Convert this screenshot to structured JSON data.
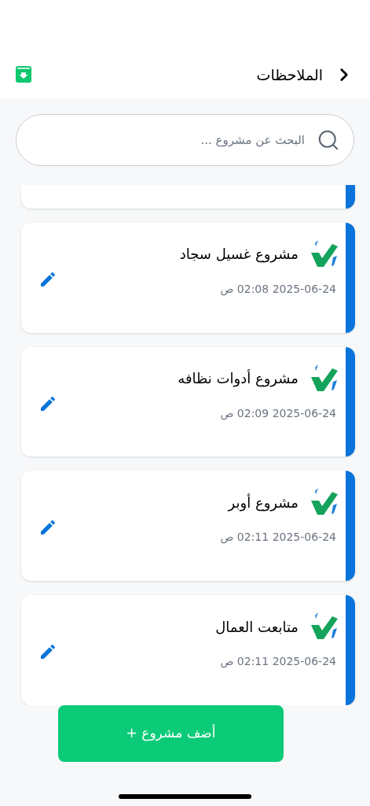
{
  "header": {
    "title": "الملاحظات"
  },
  "search": {
    "placeholder": "البحث عن مشروع ..."
  },
  "projects": [
    {
      "name": "مشروع غسيل سجاد",
      "date": "2025-06-24 02:08 ص"
    },
    {
      "name": "مشروع أدوات نظافه",
      "date": "2025-06-24 02:09 ص"
    },
    {
      "name": "مشروع أوبر",
      "date": "2025-06-24 02:11 ص"
    },
    {
      "name": "متابعت العمال",
      "date": "2025-06-24 02:11 ص"
    }
  ],
  "add_button": {
    "label": "أضف مشروع +"
  }
}
